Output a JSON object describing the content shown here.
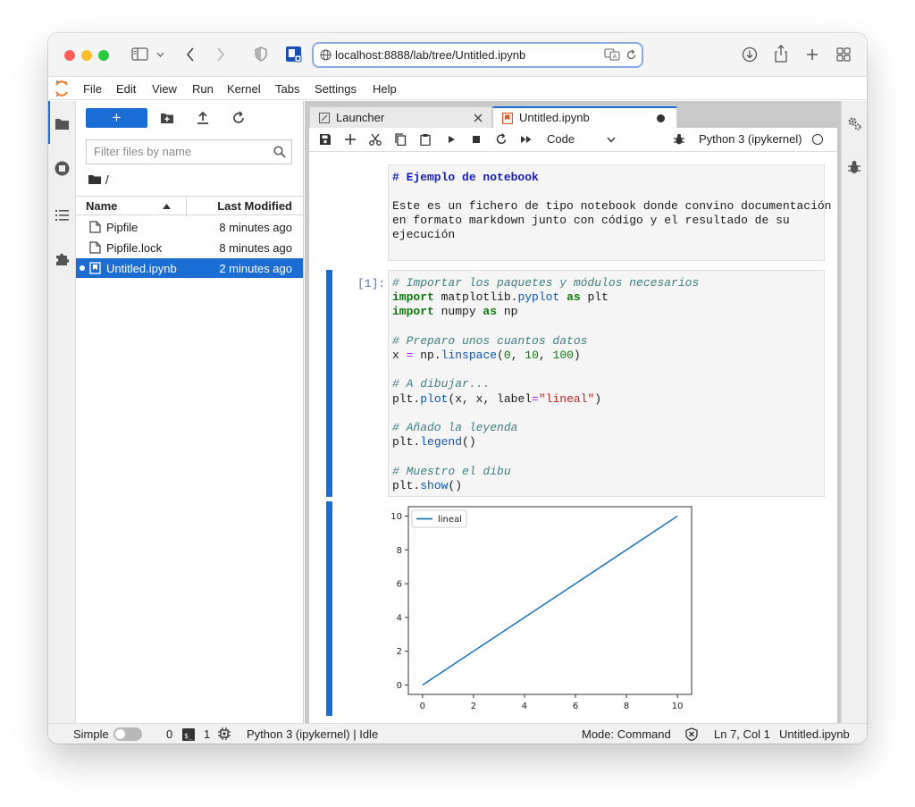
{
  "browser": {
    "url": "localhost:8888/lab/tree/Untitled.ipynb",
    "colors": {
      "close": "#fe5f57",
      "minimize": "#febc2e",
      "zoom": "#28c840",
      "accent": "#1a6dd2"
    }
  },
  "menubar": {
    "items": [
      "File",
      "Edit",
      "View",
      "Run",
      "Kernel",
      "Tabs",
      "Settings",
      "Help"
    ]
  },
  "filebrowser": {
    "new_label": "+",
    "filter_placeholder": "Filter files by name",
    "path": "/",
    "columns": {
      "name": "Name",
      "modified": "Last Modified"
    },
    "files": [
      {
        "name": "Pipfile",
        "modified": "8 minutes ago",
        "icon": "file-icon",
        "selected": false
      },
      {
        "name": "Pipfile.lock",
        "modified": "8 minutes ago",
        "icon": "file-icon",
        "selected": false
      },
      {
        "name": "Untitled.ipynb",
        "modified": "2 minutes ago",
        "icon": "notebook-icon",
        "selected": true
      }
    ]
  },
  "tabs": [
    {
      "label": "Launcher",
      "icon": "launcher-icon",
      "active": false
    },
    {
      "label": "Untitled.ipynb",
      "icon": "notebook-icon",
      "active": true
    }
  ],
  "notebook_toolbar": {
    "cell_type": "Code",
    "kernel": "Python 3 (ipykernel)"
  },
  "cells": {
    "markdown": {
      "heading": "# Ejemplo de notebook",
      "body": [
        "Este es un fichero de tipo notebook donde convino documentación",
        "en formato markdown junto con código y el resultado de su",
        "ejecución"
      ]
    },
    "code": {
      "prompt": "[1]:",
      "lines": [
        [
          {
            "t": "# Importar los paquetes y módulos necesarios",
            "c": "cm"
          }
        ],
        [
          {
            "t": "import",
            "c": "kw"
          },
          {
            "t": " matplotlib",
            "c": ""
          },
          {
            "t": ".",
            "c": ""
          },
          {
            "t": "pyplot",
            "c": "fn"
          },
          {
            "t": " ",
            "c": ""
          },
          {
            "t": "as",
            "c": "kw"
          },
          {
            "t": " plt",
            "c": ""
          }
        ],
        [
          {
            "t": "import",
            "c": "kw"
          },
          {
            "t": " numpy ",
            "c": ""
          },
          {
            "t": "as",
            "c": "kw"
          },
          {
            "t": " np",
            "c": ""
          }
        ],
        [],
        [
          {
            "t": "# Preparo unos cuantos datos",
            "c": "cm"
          }
        ],
        [
          {
            "t": "x ",
            "c": ""
          },
          {
            "t": "=",
            "c": "eq"
          },
          {
            "t": " np.",
            "c": ""
          },
          {
            "t": "linspace",
            "c": "fn"
          },
          {
            "t": "(",
            "c": ""
          },
          {
            "t": "0",
            "c": "nm"
          },
          {
            "t": ", ",
            "c": ""
          },
          {
            "t": "10",
            "c": "nm"
          },
          {
            "t": ", ",
            "c": ""
          },
          {
            "t": "100",
            "c": "nm"
          },
          {
            "t": ")",
            "c": ""
          }
        ],
        [],
        [
          {
            "t": "# A dibujar...",
            "c": "cm"
          }
        ],
        [
          {
            "t": "plt.",
            "c": ""
          },
          {
            "t": "plot",
            "c": "fn"
          },
          {
            "t": "(x, x, label",
            "c": ""
          },
          {
            "t": "=",
            "c": "eq"
          },
          {
            "t": "\"lineal\"",
            "c": "st"
          },
          {
            "t": ")",
            "c": ""
          }
        ],
        [],
        [
          {
            "t": "# Añado la leyenda",
            "c": "cm"
          }
        ],
        [
          {
            "t": "plt.",
            "c": ""
          },
          {
            "t": "legend",
            "c": "fn"
          },
          {
            "t": "()",
            "c": ""
          }
        ],
        [],
        [
          {
            "t": "# Muestro el dibu",
            "c": "cm"
          }
        ],
        [
          {
            "t": "plt.",
            "c": ""
          },
          {
            "t": "show",
            "c": "fn"
          },
          {
            "t": "()",
            "c": ""
          }
        ]
      ]
    }
  },
  "chart_data": {
    "type": "line",
    "series": [
      {
        "name": "lineal",
        "x": [
          0,
          10
        ],
        "y": [
          0,
          10
        ],
        "color": "#1f77b4"
      }
    ],
    "xticks": [
      "0",
      "2",
      "4",
      "6",
      "8",
      "10"
    ],
    "yticks": [
      "0",
      "2",
      "4",
      "6",
      "8",
      "10"
    ],
    "xlim": [
      0,
      10
    ],
    "ylim": [
      0,
      10
    ],
    "legend": "upper left",
    "grid": false
  },
  "statusbar": {
    "mode_label": "Simple",
    "terminals": "0",
    "kernels": "1",
    "kernel_status": "Python 3 (ipykernel) | Idle",
    "mode": "Mode: Command",
    "cursor": "Ln 7, Col 1",
    "filename": "Untitled.ipynb"
  }
}
